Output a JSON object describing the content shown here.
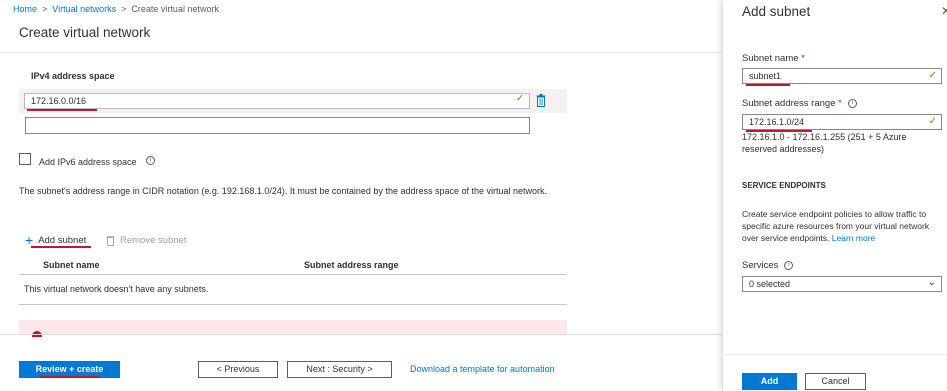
{
  "breadcrumb": {
    "home": "Home",
    "virtual_networks": "Virtual networks",
    "current": "Create virtual network",
    "separator": ">"
  },
  "page": {
    "title": "Create virtual network"
  },
  "ipv4": {
    "label": "IPv4 address space",
    "value": "172.16.0.0/16",
    "empty_value": ""
  },
  "ipv6": {
    "label": "Add IPv6 address space",
    "checked": false
  },
  "description": "The subnet's address range in CIDR notation (e.g. 192.168.1.0/24). It must be contained by the address space of the virtual network.",
  "subnet_actions": {
    "add": "Add subnet",
    "remove": "Remove subnet"
  },
  "subnet_table": {
    "columns": [
      "Subnet name",
      "Subnet address range"
    ],
    "empty_message": "This virtual network doesn't have any subnets."
  },
  "footer": {
    "review_create": "Review + create",
    "previous": "< Previous",
    "next": "Next : Security >",
    "download_template": "Download a template for automation"
  },
  "panel": {
    "title": "Add subnet",
    "subnet_name_label": "Subnet name",
    "subnet_name_value": "subnet1",
    "range_label": "Subnet address range",
    "required_marker": "*",
    "range_value": "172.16.1.0/24",
    "range_note": "172.16.1.0 - 172.16.1.255 (251 + 5 Azure reserved addresses)",
    "service_endpoints_heading": "SERVICE ENDPOINTS",
    "service_endpoints_desc": "Create service endpoint policies to allow traffic to specific azure resources from your virtual network over service endpoints.",
    "learn_more": "Learn more",
    "services_label": "Services",
    "services_value": "0 selected",
    "add_button": "Add",
    "cancel_button": "Cancel"
  },
  "colors": {
    "accent": "#0078d4",
    "annotation_red": "#c0192e",
    "success_green": "#57a300",
    "error_bg": "#fde7e9"
  },
  "icons": {
    "check": "checkmark-icon",
    "trash": "trash-icon",
    "info": "info-icon",
    "plus": "plus-icon",
    "chevron": "chevron-down-icon",
    "close": "close-icon"
  }
}
